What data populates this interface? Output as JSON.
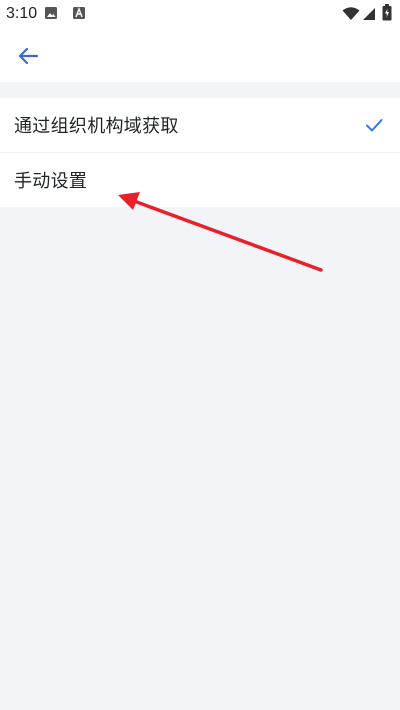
{
  "status_bar": {
    "time": "3:10",
    "icons": [
      "image-icon",
      "font-a-icon",
      "wifi-icon",
      "signal-icon",
      "battery-icon"
    ]
  },
  "header": {
    "back_icon": "arrow-left-icon"
  },
  "options": [
    {
      "label": "通过组织机构域获取",
      "selected": true
    },
    {
      "label": "手动设置",
      "selected": false
    }
  ],
  "colors": {
    "accent": "#3b6bc4",
    "check": "#3a7bdc",
    "annotation": "#e8202a",
    "background": "#f3f4f7"
  }
}
